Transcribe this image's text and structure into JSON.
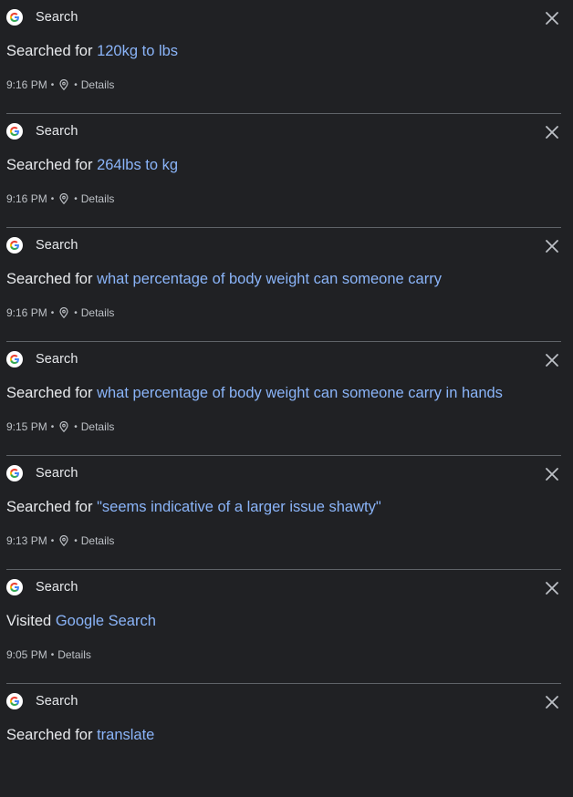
{
  "colors": {
    "background": "#202124",
    "text": "#e8eaed",
    "link": "#8ab4f8",
    "meta": "#bdc1c6",
    "divider": "#5f6368"
  },
  "entries": [
    {
      "product": "Search",
      "action": "Searched for",
      "target": "120kg to lbs",
      "time": "9:16 PM",
      "has_location": true,
      "details": "Details"
    },
    {
      "product": "Search",
      "action": "Searched for",
      "target": "264lbs to kg",
      "time": "9:16 PM",
      "has_location": true,
      "details": "Details"
    },
    {
      "product": "Search",
      "action": "Searched for",
      "target": "what percentage of body weight can someone carry",
      "time": "9:16 PM",
      "has_location": true,
      "details": "Details"
    },
    {
      "product": "Search",
      "action": "Searched for",
      "target": "what percentage of body weight can someone carry in hands",
      "time": "9:15 PM",
      "has_location": true,
      "details": "Details"
    },
    {
      "product": "Search",
      "action": "Searched for",
      "target": "\"seems indicative of a larger issue shawty\"",
      "time": "9:13 PM",
      "has_location": true,
      "details": "Details"
    },
    {
      "product": "Search",
      "action": "Visited",
      "target": "Google Search",
      "time": "9:05 PM",
      "has_location": false,
      "details": "Details"
    },
    {
      "product": "Search",
      "action": "Searched for",
      "target": "translate",
      "time": "",
      "has_location": false,
      "details": ""
    }
  ],
  "icons": {
    "product": "google-g-icon",
    "delete": "close-icon",
    "location": "location-pin-icon"
  }
}
